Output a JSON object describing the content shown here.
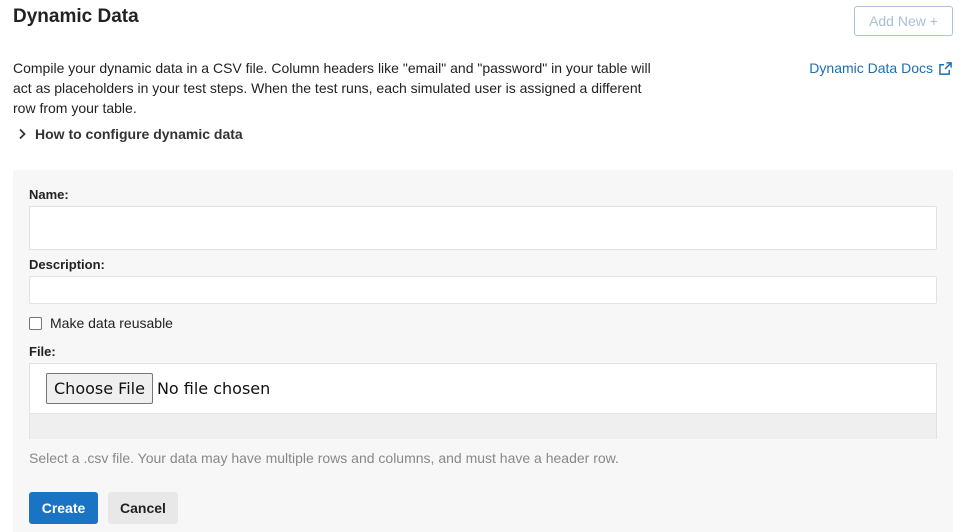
{
  "header": {
    "title": "Dynamic Data",
    "add_new_label": "Add New +"
  },
  "intro": {
    "text": "Compile your dynamic data in a CSV file. Column headers like \"email\" and \"password\" in your table will act as placeholders in your test steps. When the test runs, each simulated user is assigned a different row from your table."
  },
  "docs_link": {
    "label": "Dynamic Data Docs",
    "icon": "external-link-icon",
    "color": "#1a6fb5"
  },
  "howto": {
    "label": "How to configure dynamic data",
    "icon": "chevron-right-icon"
  },
  "form": {
    "name_label": "Name:",
    "name_value": "",
    "description_label": "Description:",
    "description_value": "",
    "reusable_label": "Make data reusable",
    "reusable_checked": false,
    "file_label": "File:",
    "choose_file_label": "Choose File",
    "no_file_text": "No file chosen",
    "help_text": "Select a .csv file. Your data may have multiple rows and columns, and must have a header row.",
    "create_label": "Create",
    "cancel_label": "Cancel"
  },
  "colors": {
    "primary": "#1b73c4",
    "panel_bg": "#f7f7f7"
  }
}
